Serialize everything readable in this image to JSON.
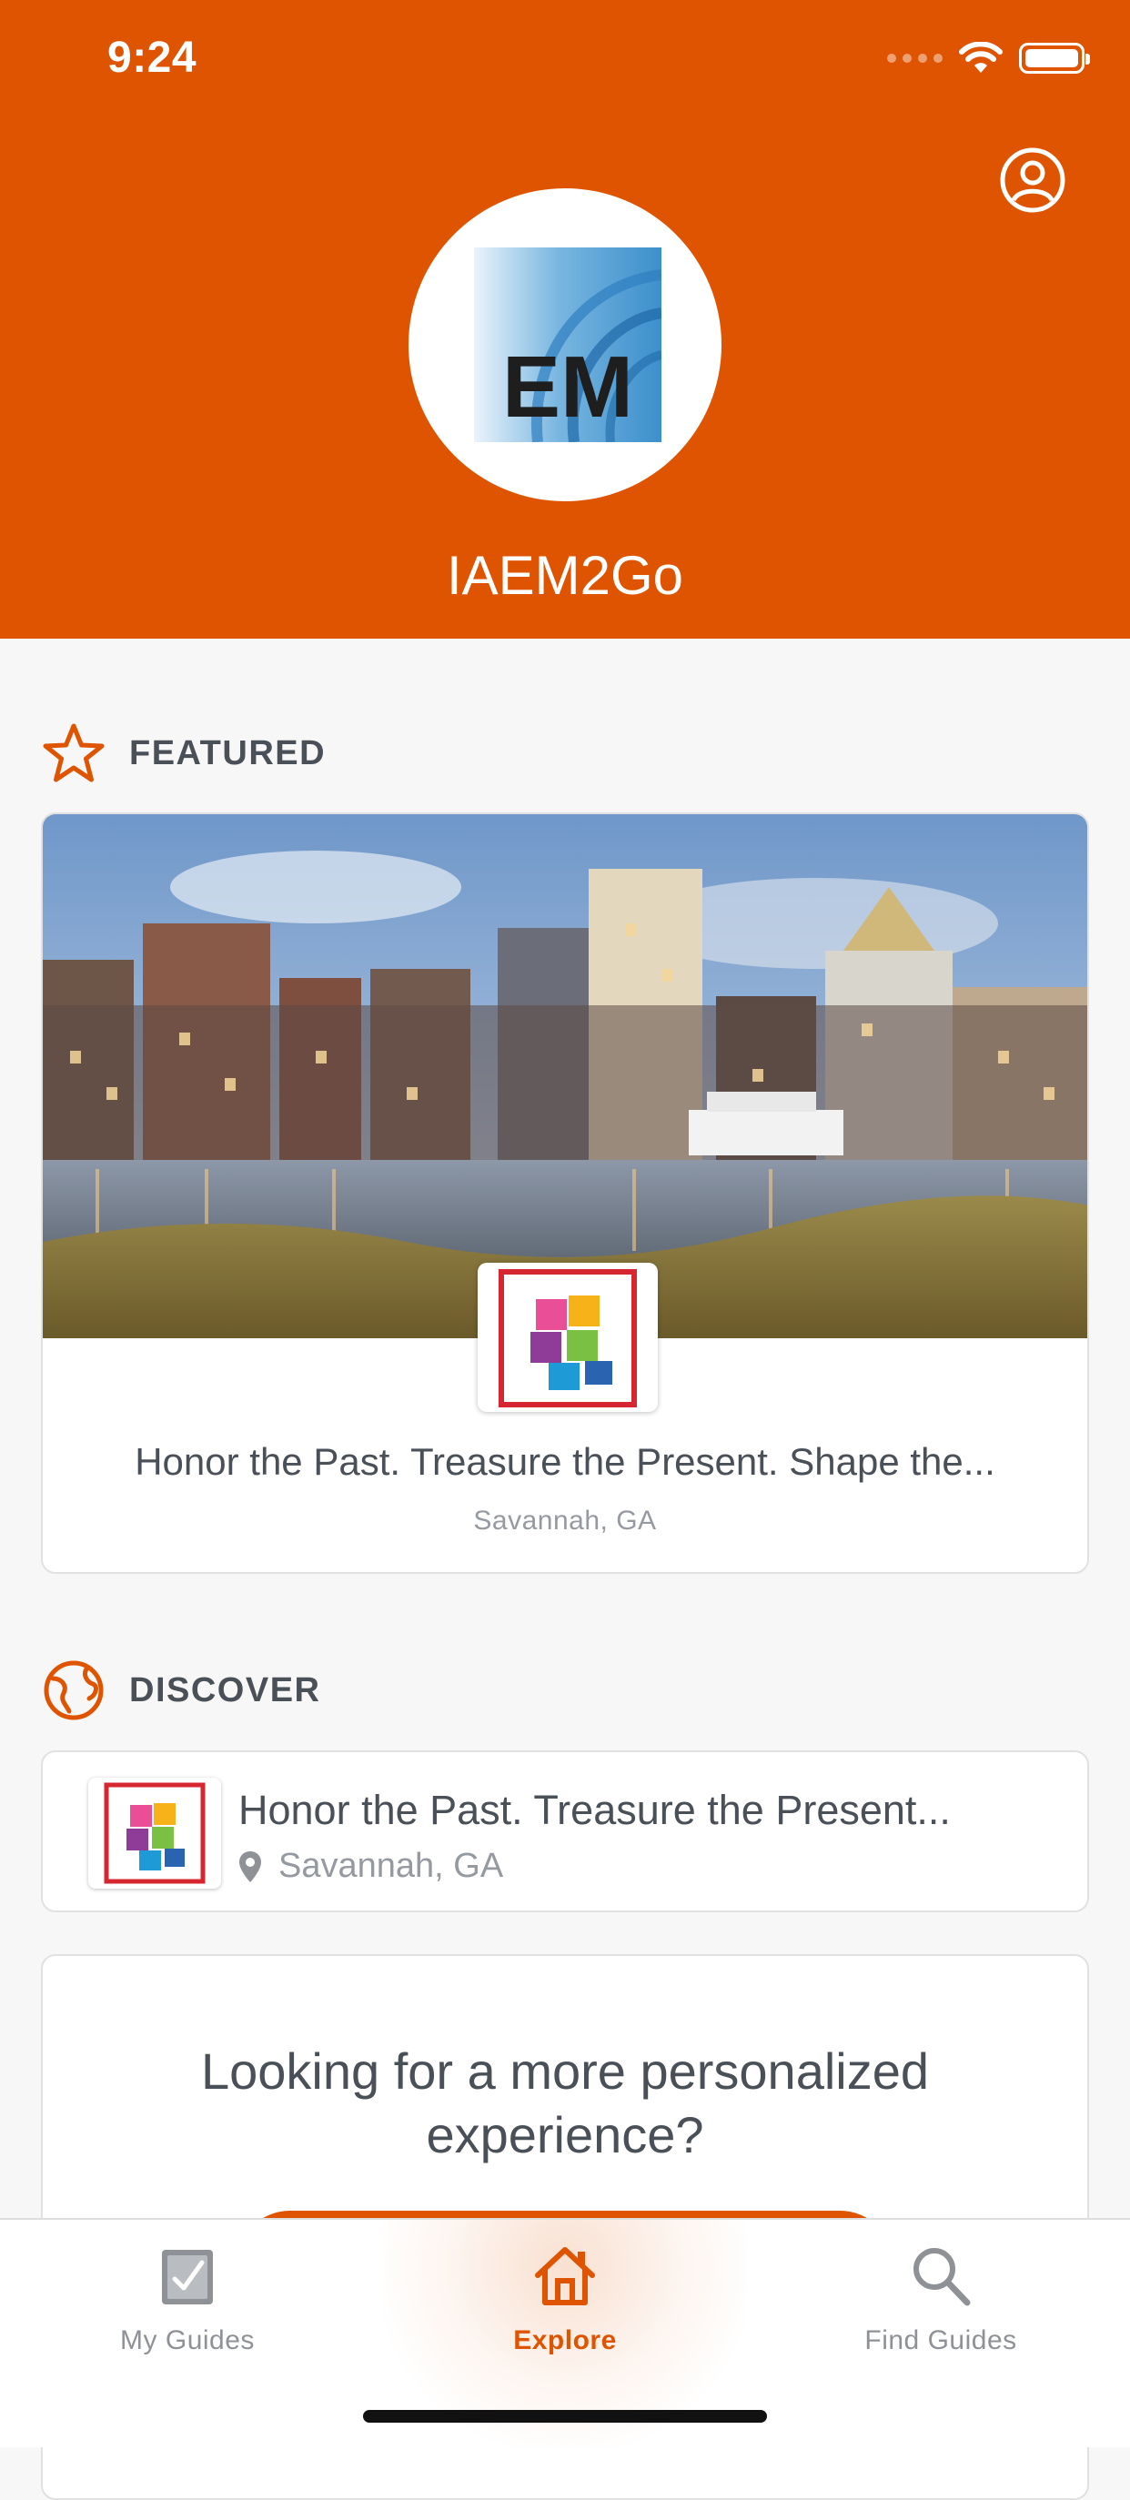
{
  "status_bar": {
    "time": "9:24"
  },
  "header": {
    "app_title": "IAEM2Go",
    "logo_text": "EM"
  },
  "featured": {
    "section_label": "FEATURED",
    "title": "Honor the Past. Treasure the Present. Shape the...",
    "location": "Savannah, GA"
  },
  "discover": {
    "section_label": "DISCOVER",
    "items": [
      {
        "title": "Honor the Past. Treasure the Present...",
        "location": "Savannah, GA"
      }
    ]
  },
  "personalized": {
    "prompt": "Looking for a more personalized experience?"
  },
  "tabbar": {
    "tabs": [
      {
        "label": "My Guides",
        "icon": "checkbox-icon",
        "active": false
      },
      {
        "label": "Explore",
        "icon": "home-icon",
        "active": true
      },
      {
        "label": "Find Guides",
        "icon": "search-icon",
        "active": false
      }
    ]
  },
  "colors": {
    "brand": "#de5400",
    "text": "#4a5058",
    "muted": "#959aa1",
    "background": "#f7f7f7"
  }
}
